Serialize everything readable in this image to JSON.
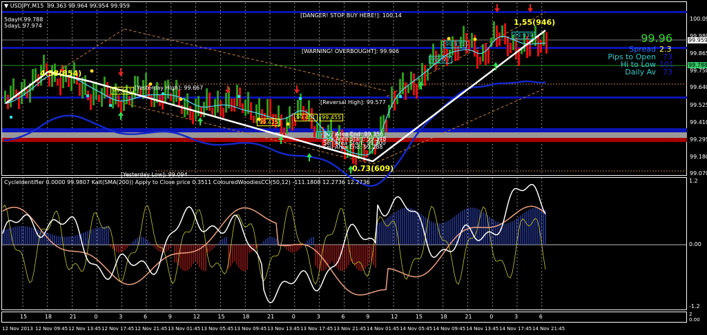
{
  "header": {
    "symbol_menu": "▼ USDJPY,M15",
    "ohlc": "99.363 99.964 99.954 99.959"
  },
  "top_left": {
    "five_day_high": "5dayH 99.788",
    "five_day_low": "5dayL 97.974"
  },
  "annotations": {
    "danger": "[DANGER! STOP BUY HERE!]: 100.14",
    "warning": "[WARNING! OVERBOUGHT]: 99.906",
    "yesterday_high": "[Yesterday High]: 99.667",
    "reversal_high": "[Reversal High]: 99.577",
    "yesterday_low": "[Yesterday Low]: 99.094",
    "buy_area_end": "Buy Area End: 99.356",
    "buy_area_start": "Buy Area Start: 99.348",
    "sell_area_start": "Sell Area Start: 99.300",
    "sell_area_end": "Sell Area End: 99.288",
    "swing1": "4.58(854)",
    "swing2": "0.73(609)",
    "swing3": "1.55(946)",
    "boxes": [
      "99.451",
      "99.455",
      "99.425",
      "99.931",
      "99.939",
      "99.827",
      "99.667",
      "99.3"
    ]
  },
  "info_panel": {
    "price": "99.96",
    "spread_label": "Spread",
    "spread_value": "2.3",
    "pips_label": "Pips to Open",
    "pips_value": "73",
    "hilo_label": "Hi to Low",
    "hilo_value": "101",
    "daily_label": "Daily Av",
    "daily_value": "73"
  },
  "price_axis": {
    "ticks": [
      "100.095",
      "99.980",
      "99.865",
      "99.750",
      "99.640",
      "99.525",
      "99.410",
      "99.295",
      "99.180",
      "99.070"
    ],
    "current_price": "99.959",
    "green_line_price": "99.788"
  },
  "indicator": {
    "label": "CycleIdentifier 0.0000 99.9807  Kalt(SMA(200)) Apply to Close price 0.3511  ColouredWoodiesCCI(50,12) -111.1808 12.2736 12.2736",
    "ticks": [
      "1.2",
      "0.00",
      "-1.2"
    ]
  },
  "time_axis": {
    "hours": [
      "15",
      "18",
      "21",
      "0",
      "3",
      "6",
      "9",
      "12",
      "15",
      "18",
      "21",
      "0",
      "3",
      "6",
      "9",
      "12",
      "15",
      "18",
      "21",
      "0",
      "3",
      "6"
    ],
    "dates": [
      "12 Nov 2013",
      "12 Nov 09:45",
      "12 Nov 13:45",
      "12 Nov 17:45",
      "12 Nov 21:45",
      "13 Nov 01:45",
      "13 Nov 05:45",
      "13 Nov 09:45",
      "13 Nov 13:45",
      "13 Nov 17:45",
      "13 Nov 21:45",
      "14 Nov 01:45",
      "14 Nov 05:45",
      "14 Nov 09:45",
      "14 Nov 13:45",
      "14 Nov 17:45",
      "14 Nov 21:45"
    ],
    "strip_scale": [
      "2",
      "0.00"
    ]
  },
  "colors": {
    "up": "#2e9a1e",
    "down": "#e01010",
    "level": "#0a14b4",
    "accent": "#ffff33",
    "cyan": "#33cccc"
  },
  "price_path": [
    [
      99.54,
      0
    ],
    [
      99.74,
      60
    ],
    [
      99.7,
      90
    ],
    [
      99.62,
      120
    ],
    [
      99.56,
      160
    ],
    [
      99.62,
      200
    ],
    [
      99.58,
      240
    ],
    [
      99.48,
      280
    ],
    [
      99.55,
      320
    ],
    [
      99.5,
      360
    ],
    [
      99.4,
      400
    ],
    [
      99.48,
      430
    ],
    [
      99.35,
      460
    ],
    [
      99.25,
      490
    ],
    [
      99.2,
      530
    ],
    [
      99.55,
      560
    ],
    [
      99.7,
      600
    ],
    [
      99.9,
      640
    ],
    [
      99.93,
      670
    ],
    [
      99.85,
      690
    ],
    [
      99.98,
      710
    ],
    [
      99.9,
      750
    ],
    [
      99.95,
      785
    ]
  ]
}
